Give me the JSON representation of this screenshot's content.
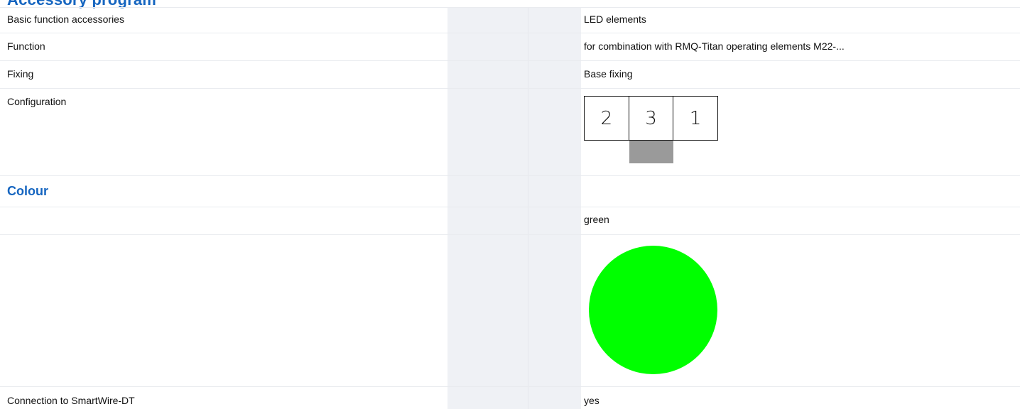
{
  "heading_partial": "Accessory program",
  "rows": {
    "basic": {
      "label": "Basic function accessories",
      "value": "LED elements"
    },
    "function": {
      "label": "Function",
      "value": "for combination with RMQ-Titan operating elements M22-..."
    },
    "fixing": {
      "label": "Fixing",
      "value": "Base fixing"
    },
    "configuration": {
      "label": "Configuration",
      "slots": [
        "2",
        "3",
        "1"
      ]
    }
  },
  "colour_section": {
    "title": "Colour",
    "value": "green",
    "swatch_color": "#00ff00",
    "base_color": "#9a9a9a"
  },
  "smartwire": {
    "label": "Connection to SmartWire-DT",
    "value": "yes"
  },
  "colors": {
    "heading": "#1565c0",
    "gray_column": "#eff1f5",
    "row_border": "#e9ebef"
  }
}
